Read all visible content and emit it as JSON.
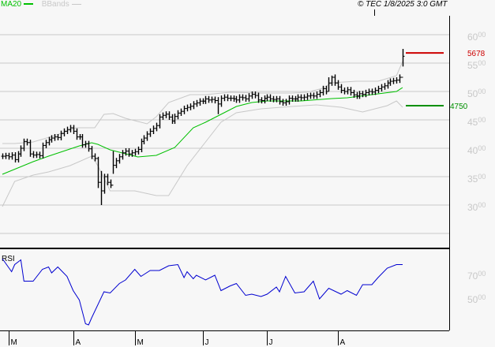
{
  "header": {
    "ma_label": "MA20",
    "bb_label": "BBands",
    "copyright": "© TEC 1/8/2025 3:0 GMT"
  },
  "colors": {
    "ma": "#00c000",
    "bands": "#c8c8c8",
    "bars": "#000000",
    "rsi": "#0000d0",
    "resistance": "#cc0000",
    "support": "#009000",
    "grid": "#c8c8c8",
    "axis_label": "#c8c8c8"
  },
  "chart_data": [
    {
      "type": "ohlc",
      "title": "",
      "ylim": [
        2300,
        6300
      ],
      "yticks": [
        {
          "value": 6000,
          "major": "60",
          "minor": "00"
        },
        {
          "value": 5500,
          "major": "55",
          "minor": "00"
        },
        {
          "value": 5000,
          "major": "50",
          "minor": "00"
        },
        {
          "value": 4500,
          "major": "45",
          "minor": "00"
        },
        {
          "value": 4000,
          "major": "40",
          "minor": "00"
        },
        {
          "value": 3500,
          "major": "35",
          "minor": "00"
        },
        {
          "value": 3000,
          "major": "30",
          "minor": "00"
        }
      ],
      "extra_grid": [
        2500
      ],
      "closes": [
        3860,
        3870,
        3850,
        3880,
        3800,
        3900,
        4000,
        4120,
        4100,
        3900,
        3880,
        3890,
        3870,
        4050,
        4100,
        4150,
        4180,
        4200,
        4190,
        4260,
        4300,
        4330,
        4360,
        4300,
        4200,
        4200,
        4060,
        4080,
        3990,
        3860,
        3820,
        3400,
        3250,
        3500,
        3400,
        3350,
        3700,
        3780,
        3850,
        3920,
        3950,
        3900,
        3920,
        3940,
        3980,
        4120,
        4180,
        4250,
        4300,
        4350,
        4400,
        4550,
        4580,
        4600,
        4550,
        4480,
        4560,
        4620,
        4650,
        4700,
        4720,
        4740,
        4780,
        4800,
        4830,
        4830,
        4870,
        4850,
        4860,
        4840,
        4780,
        4880,
        4900,
        4880,
        4880,
        4870,
        4850,
        4900,
        4890,
        4870,
        4920,
        4950,
        4930,
        4850,
        4840,
        4880,
        4900,
        4870,
        4860,
        4870,
        4820,
        4800,
        4820,
        4880,
        4870,
        4870,
        4900,
        4890,
        4900,
        4920,
        4930,
        4920,
        4950,
        4980,
        5050,
        5000,
        5150,
        5250,
        5150,
        5080,
        5020,
        5000,
        5030,
        4980,
        4940,
        4920,
        4960,
        4950,
        4980,
        5000,
        4990,
        5020,
        5050,
        5080,
        5100,
        5150,
        5180,
        5190,
        5200,
        5250,
        5620
      ],
      "range_overrides": [
        {
          "i": 31,
          "low": 3300,
          "high": 3850
        },
        {
          "i": 32,
          "low": 3000,
          "high": 3600
        },
        {
          "i": 36,
          "low": 3550,
          "high": 3950
        },
        {
          "i": 70,
          "low": 4600,
          "high": 4900
        },
        {
          "i": 106,
          "low": 5000,
          "high": 5250
        },
        {
          "i": 107,
          "low": 5100,
          "high": 5280
        },
        {
          "i": 130,
          "low": 5440,
          "high": 5750
        }
      ],
      "ma20": [
        [
          0,
          3541
        ],
        [
          10,
          3764
        ],
        [
          15,
          3861
        ],
        [
          25,
          4041
        ],
        [
          29,
          4097
        ],
        [
          31,
          4069
        ],
        [
          35,
          3972
        ],
        [
          44,
          3847
        ],
        [
          50,
          3875
        ],
        [
          56,
          4014
        ],
        [
          62,
          4361
        ],
        [
          66,
          4458
        ],
        [
          71,
          4597
        ],
        [
          76,
          4736
        ],
        [
          81,
          4805
        ],
        [
          86,
          4833
        ],
        [
          97,
          4833
        ],
        [
          107,
          4875
        ],
        [
          112,
          4889
        ],
        [
          120,
          4944
        ],
        [
          128,
          5000
        ],
        [
          130,
          5069
        ]
      ],
      "upper_band": [
        [
          0,
          4083
        ],
        [
          4,
          4083
        ],
        [
          10,
          4111
        ],
        [
          17,
          4222
        ],
        [
          24,
          4361
        ],
        [
          30,
          4361
        ],
        [
          33,
          4597
        ],
        [
          36,
          4611
        ],
        [
          40,
          4528
        ],
        [
          47,
          4431
        ],
        [
          50,
          4556
        ],
        [
          54,
          4806
        ],
        [
          61,
          4944
        ],
        [
          66,
          4944
        ],
        [
          74,
          4986
        ],
        [
          84,
          4972
        ],
        [
          94,
          4972
        ],
        [
          99,
          4986
        ],
        [
          104,
          5056
        ],
        [
          107,
          5153
        ],
        [
          115,
          5181
        ],
        [
          122,
          5181
        ],
        [
          128,
          5278
        ],
        [
          130,
          5528
        ]
      ],
      "lower_band": [
        [
          0,
          2972
        ],
        [
          4,
          3417
        ],
        [
          10,
          3528
        ],
        [
          15,
          3583
        ],
        [
          22,
          3694
        ],
        [
          29,
          3861
        ],
        [
          31,
          3694
        ],
        [
          35,
          3250
        ],
        [
          43,
          3250
        ],
        [
          50,
          3167
        ],
        [
          54,
          3167
        ],
        [
          60,
          3694
        ],
        [
          66,
          4111
        ],
        [
          71,
          4458
        ],
        [
          76,
          4625
        ],
        [
          84,
          4694
        ],
        [
          94,
          4736
        ],
        [
          102,
          4764
        ],
        [
          110,
          4722
        ],
        [
          117,
          4639
        ],
        [
          125,
          4750
        ],
        [
          128,
          4833
        ],
        [
          130,
          4722
        ]
      ],
      "levels": [
        {
          "name": "resistance",
          "value": 5678,
          "label": "5678"
        },
        {
          "name": "support",
          "value": 4750,
          "label": "4750"
        }
      ],
      "legend": [
        "MA20",
        "BBands"
      ]
    },
    {
      "type": "line",
      "title": "RSI",
      "ylim": [
        14,
        84
      ],
      "yticks": [
        {
          "value": 70,
          "major": "70",
          "minor": "00"
        },
        {
          "value": 50,
          "major": "50",
          "minor": "00"
        }
      ],
      "points": [
        [
          0,
          84
        ],
        [
          3,
          73
        ],
        [
          4,
          79
        ],
        [
          6,
          83
        ],
        [
          7,
          65
        ],
        [
          10,
          65
        ],
        [
          13,
          75
        ],
        [
          15,
          77
        ],
        [
          16,
          72
        ],
        [
          18,
          77
        ],
        [
          21,
          69
        ],
        [
          23,
          57
        ],
        [
          25,
          49
        ],
        [
          27,
          29
        ],
        [
          28,
          28
        ],
        [
          29,
          34
        ],
        [
          33,
          56
        ],
        [
          35,
          55
        ],
        [
          38,
          63
        ],
        [
          40,
          66
        ],
        [
          43,
          75
        ],
        [
          45,
          69
        ],
        [
          48,
          74
        ],
        [
          51,
          74
        ],
        [
          54,
          78
        ],
        [
          57,
          79
        ],
        [
          59,
          68
        ],
        [
          60,
          73
        ],
        [
          62,
          67
        ],
        [
          63,
          70
        ],
        [
          66,
          66
        ],
        [
          69,
          70
        ],
        [
          71,
          57
        ],
        [
          74,
          61
        ],
        [
          76,
          63
        ],
        [
          79,
          53
        ],
        [
          81,
          54
        ],
        [
          84,
          52
        ],
        [
          86,
          54
        ],
        [
          89,
          60
        ],
        [
          90,
          56
        ],
        [
          92,
          69
        ],
        [
          95,
          55
        ],
        [
          98,
          56
        ],
        [
          101,
          65
        ],
        [
          103,
          50
        ],
        [
          106,
          59
        ],
        [
          110,
          54
        ],
        [
          112,
          57
        ],
        [
          115,
          53
        ],
        [
          117,
          62
        ],
        [
          120,
          62
        ],
        [
          122,
          68
        ],
        [
          125,
          76
        ],
        [
          128,
          79
        ],
        [
          130,
          79
        ]
      ]
    }
  ],
  "x_axis": {
    "ticks": [
      {
        "bar": 2,
        "label": "M"
      },
      {
        "bar": 23,
        "label": "A"
      },
      {
        "bar": 43,
        "label": "M"
      },
      {
        "bar": 65,
        "label": "J"
      },
      {
        "bar": 86,
        "label": "J"
      },
      {
        "bar": 109,
        "label": "A"
      }
    ]
  }
}
